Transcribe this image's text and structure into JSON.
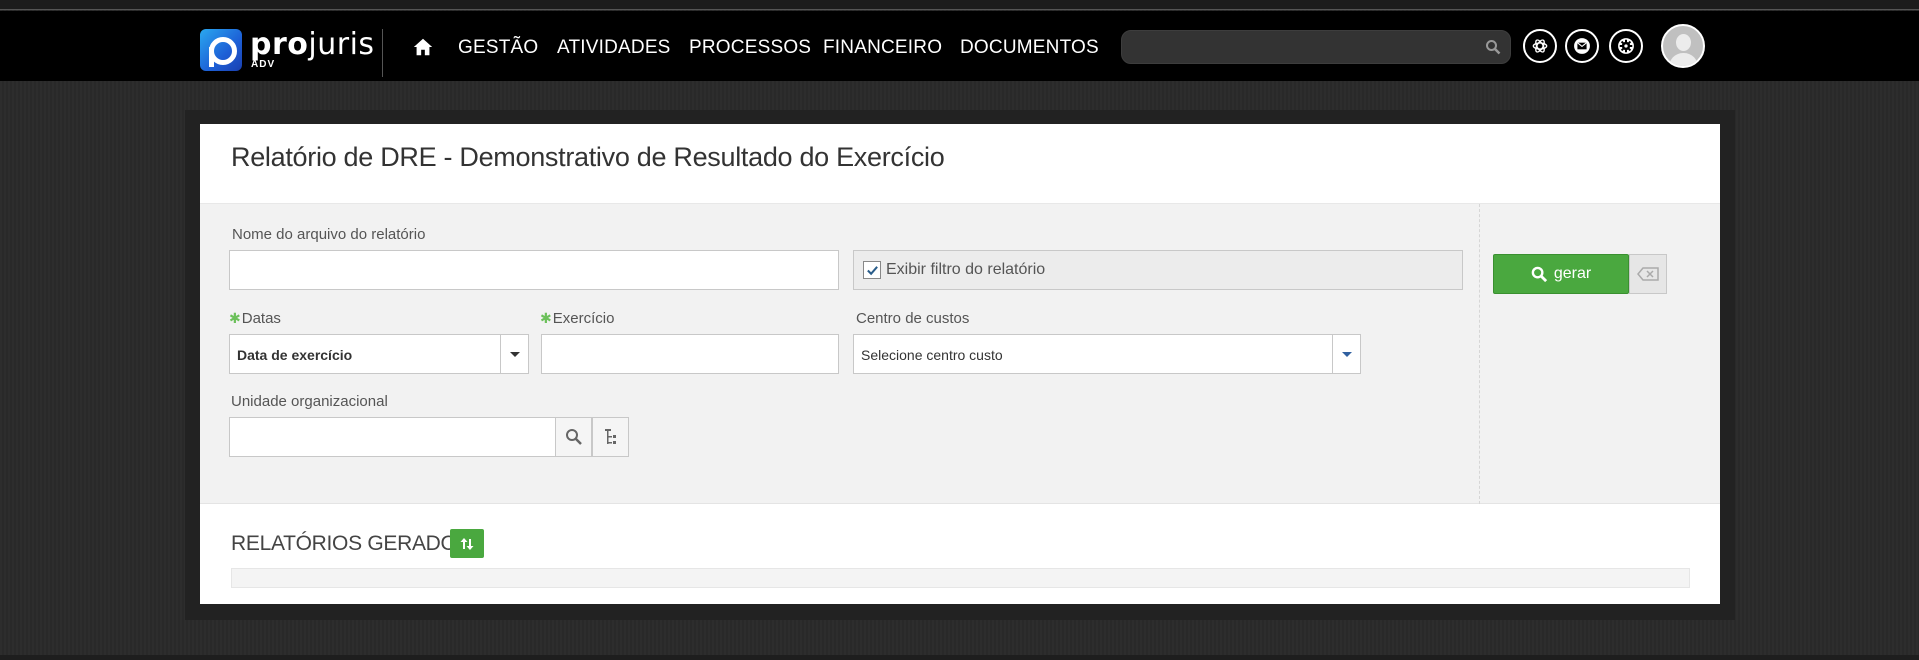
{
  "brand": {
    "name_bold": "pro",
    "name_light": "juris",
    "sub": "ADV"
  },
  "nav": {
    "items": [
      "GESTÃO",
      "ATIVIDADES",
      "PROCESSOS",
      "FINANCEIRO",
      "DOCUMENTOS"
    ],
    "search": {
      "value": "",
      "placeholder": ""
    },
    "icons": [
      "home-icon",
      "search-icon",
      "openai-icon",
      "mail-icon",
      "gear-icon",
      "avatar"
    ]
  },
  "page": {
    "title": "Relatório de DRE - Demonstrativo de Resultado do Exercício"
  },
  "filters": {
    "file_name": {
      "label": "Nome do arquivo do relatório",
      "value": ""
    },
    "show_filter": {
      "label": "Exibir filtro do relatório",
      "checked": true
    },
    "datas": {
      "label": "Datas",
      "value": "Data de exercício",
      "required": true
    },
    "exercicio": {
      "label": "Exercício",
      "value": "",
      "required": true
    },
    "centro_custos": {
      "label": "Centro de custos",
      "value": "Selecione centro custo"
    },
    "unidade": {
      "label": "Unidade organizacional",
      "value": ""
    }
  },
  "actions": {
    "generate_label": "gerar"
  },
  "reports": {
    "title": "RELATÓRIOS GERADOS"
  },
  "colors": {
    "accent_green": "#4aa83f",
    "navbar": "#000000",
    "required_star": "#6cc05a"
  }
}
